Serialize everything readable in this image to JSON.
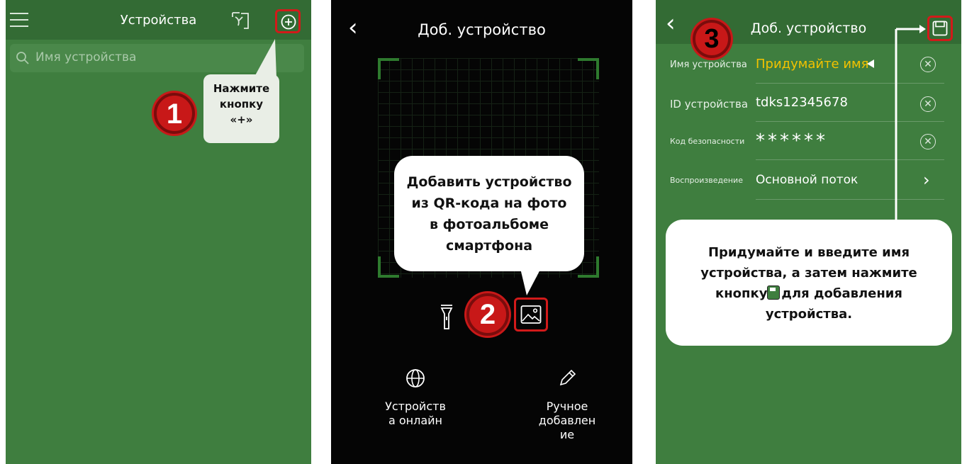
{
  "panel1": {
    "title": "Устройства",
    "search_placeholder": "Имя устройства",
    "step_number": "1",
    "callout_lines": [
      "Нажмите",
      "кнопку",
      "«+»"
    ]
  },
  "panel2": {
    "title": "Доб. устройство",
    "step_number": "2",
    "callout_lines": [
      "Добавить устройство",
      "из QR-кода на фото",
      "в фотоальбоме",
      "смартфона"
    ],
    "online_lines": [
      "Устройств",
      "а онлайн"
    ],
    "manual_lines": [
      "Ручное",
      "добавлен",
      "ие"
    ]
  },
  "panel3": {
    "title": "Доб. устройство",
    "step_number": "3",
    "fields": [
      {
        "label": "Имя устройства",
        "value": "Придумайте имя"
      },
      {
        "label": "ID устройства",
        "value": "tdks12345678"
      },
      {
        "label": "Код безопасности",
        "value": "******"
      },
      {
        "label": "Воспроизведение",
        "value": "Основной поток"
      }
    ],
    "callout_lines": [
      "Придумайте и введите имя",
      "устройства, а затем нажмите",
      "кнопку",
      "для добавления",
      "устройства."
    ]
  },
  "colors": {
    "app_green": "#3f7e3f",
    "highlight_red": "#d21a1a",
    "name_placeholder_yellow": "#f2c200"
  }
}
